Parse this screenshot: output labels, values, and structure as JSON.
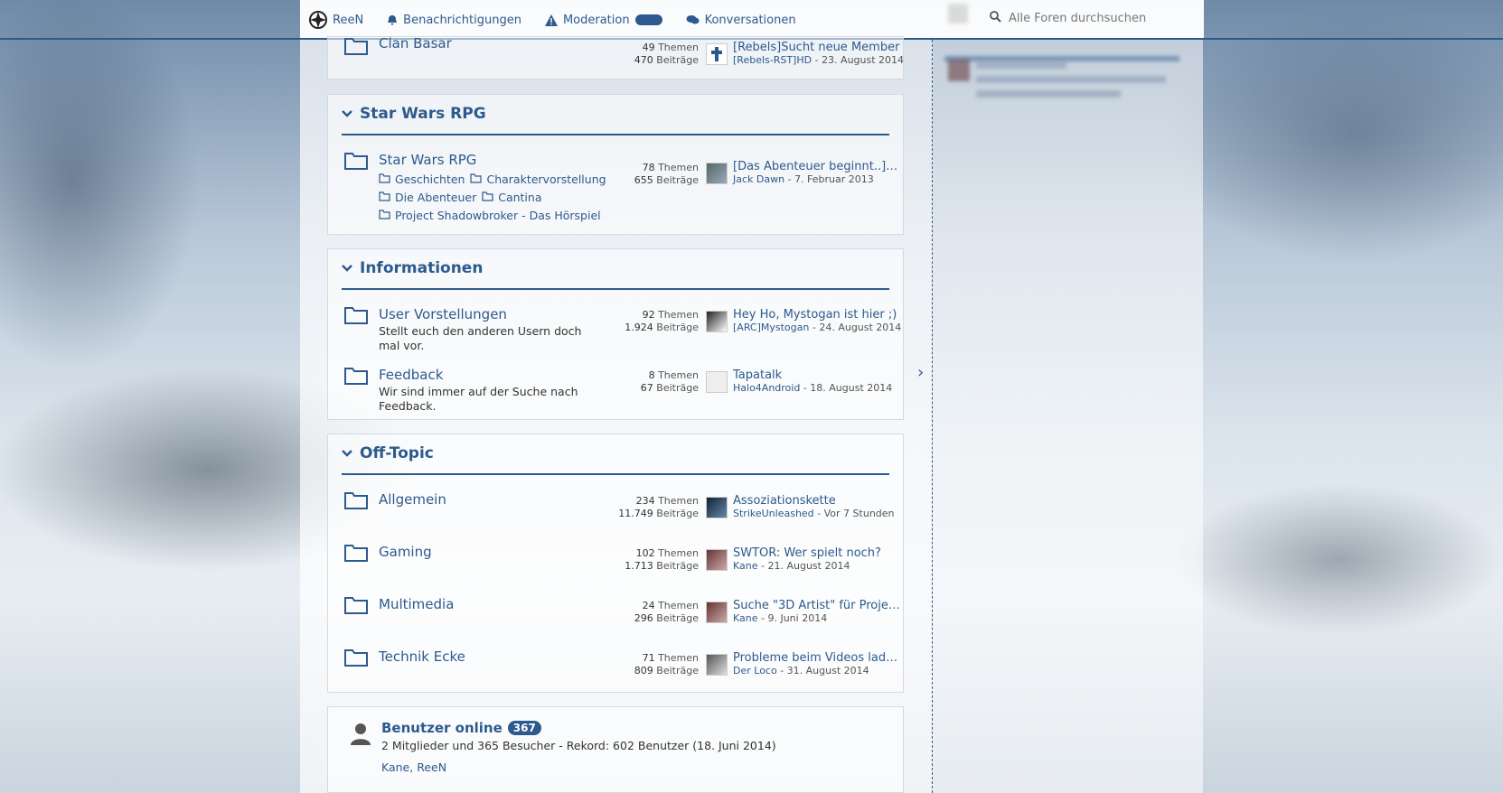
{
  "nav": {
    "user": "ReeN",
    "notifications": "Benachrichtigungen",
    "moderation": "Moderation",
    "conversations": "Konversationen",
    "search_placeholder": "Alle Foren durchsuchen"
  },
  "categories": [
    {
      "forums": [
        {
          "title": "Clan Basar",
          "themes": "49",
          "posts": "470",
          "last_title": "[Rebels]Sucht neue Member",
          "last_user": "[Rebels-RST]HD",
          "last_date": "23. August 2014"
        }
      ]
    },
    {
      "title": "Star Wars RPG",
      "forums": [
        {
          "title": "Star Wars RPG",
          "themes": "78",
          "posts": "655",
          "last_title": "[Das Abenteuer beginnt..] St...",
          "last_user": "Jack Dawn",
          "last_date": "7. Februar 2013",
          "subforums": [
            "Geschichten",
            "Charaktervorstellung",
            "Die Abenteuer",
            "Cantina",
            "Project Shadowbroker - Das Hörspiel"
          ]
        }
      ]
    },
    {
      "title": "Informationen",
      "forums": [
        {
          "title": "User Vorstellungen",
          "desc": "Stellt euch den anderen Usern doch mal vor.",
          "themes": "92",
          "posts": "1.924",
          "last_title": "Hey Ho, Mystogan ist hier ;)",
          "last_user": "[ARC]Mystogan",
          "last_date": "24. August 2014"
        },
        {
          "title": "Feedback",
          "desc": "Wir sind immer auf der Suche nach Feedback.",
          "themes": "8",
          "posts": "67",
          "last_title": "Tapatalk",
          "last_user": "Halo4Android",
          "last_date": "18. August 2014"
        }
      ]
    },
    {
      "title": "Off-Topic",
      "forums": [
        {
          "title": "Allgemein",
          "themes": "234",
          "posts": "11.749",
          "last_title": "Assoziationskette",
          "last_user": "StrikeUnleashed",
          "last_date": "Vor 7 Stunden"
        },
        {
          "title": "Gaming",
          "themes": "102",
          "posts": "1.713",
          "last_title": "SWTOR: Wer spielt noch?",
          "last_user": "Kane",
          "last_date": "21. August 2014"
        },
        {
          "title": "Multimedia",
          "themes": "24",
          "posts": "296",
          "last_title": "Suche \"3D Artist\" für Projekt!",
          "last_user": "Kane",
          "last_date": "9. Juni 2014"
        },
        {
          "title": "Technik Ecke",
          "themes": "71",
          "posts": "809",
          "last_title": "Probleme beim Videos laden",
          "last_user": "Der Loco",
          "last_date": "31. August 2014"
        }
      ]
    }
  ],
  "labels": {
    "themes": "Themen",
    "posts": "Beiträge"
  },
  "online": {
    "title": "Benutzer online",
    "count": "367",
    "text": "2 Mitglieder und 365 Besucher - Rekord: 602 Benutzer (18. Juni 2014)",
    "users": "Kane, ReeN"
  },
  "colors": {
    "accent": "#2d5a8e"
  }
}
